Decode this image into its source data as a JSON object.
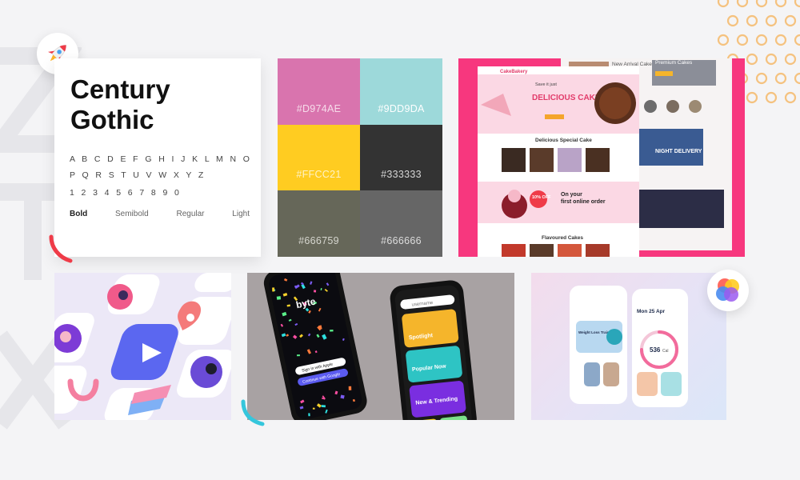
{
  "typography": {
    "font_name": "Century Gothic",
    "alphabet": "A B C D E F G H I J K L M N O P Q R S T U V W X Y Z",
    "digits": "1 2 3 4 5 6 7 8 9 0",
    "weights": [
      "Bold",
      "Semibold",
      "Regular",
      "Light"
    ]
  },
  "palette": [
    {
      "hex": "#D974AE",
      "label": "#D974AE",
      "text_color": "#f6dcea"
    },
    {
      "hex": "#9DD9DA",
      "label": "#9DD9DA",
      "text_color": "#ffffff"
    },
    {
      "hex": "#FFCC21",
      "label": "#FFCC21",
      "text_color": "#fff3c7"
    },
    {
      "hex": "#333333",
      "label": "#333333",
      "text_color": "#d6d6d6"
    },
    {
      "hex": "#666759",
      "label": "#666759",
      "text_color": "#d6d6cf"
    },
    {
      "hex": "#666666",
      "label": "#666666",
      "text_color": "#dddddd"
    }
  ],
  "website_mockup": {
    "logo": "CakeBakery",
    "hero_kicker": "Save it just",
    "hero_title": "DELICIOUS CAKE",
    "section_special": "Delicious Special Cake",
    "promo_off": "10% OFF",
    "promo_line1": "On your",
    "promo_line2": "first online order",
    "section_flavoured": "Flavoured Cakes",
    "tab_new_arrival": "New Arrival Cakes",
    "tab_premium": "Premium Cakes",
    "banner_night": "NIGHT DELIVERY"
  },
  "byte_mockup": {
    "app_name": "byte",
    "sign_in_apple": "Sign in with Apple",
    "sign_in_google": "Continue with Google",
    "search_placeholder": "username",
    "cards": [
      "Spotlight",
      "Popular Now",
      "New & Trending"
    ]
  },
  "fitness_mockup": {
    "date": "Mon 25 Apr",
    "calories_value": "536",
    "calories_unit": "Cal",
    "program": "Weight Loss Training"
  },
  "colors": {
    "background": "#f4f4f6",
    "web_accent": "#f7377e",
    "dots": "#f5c27f"
  },
  "icons": [
    "rocket-icon",
    "color-circles-icon"
  ]
}
